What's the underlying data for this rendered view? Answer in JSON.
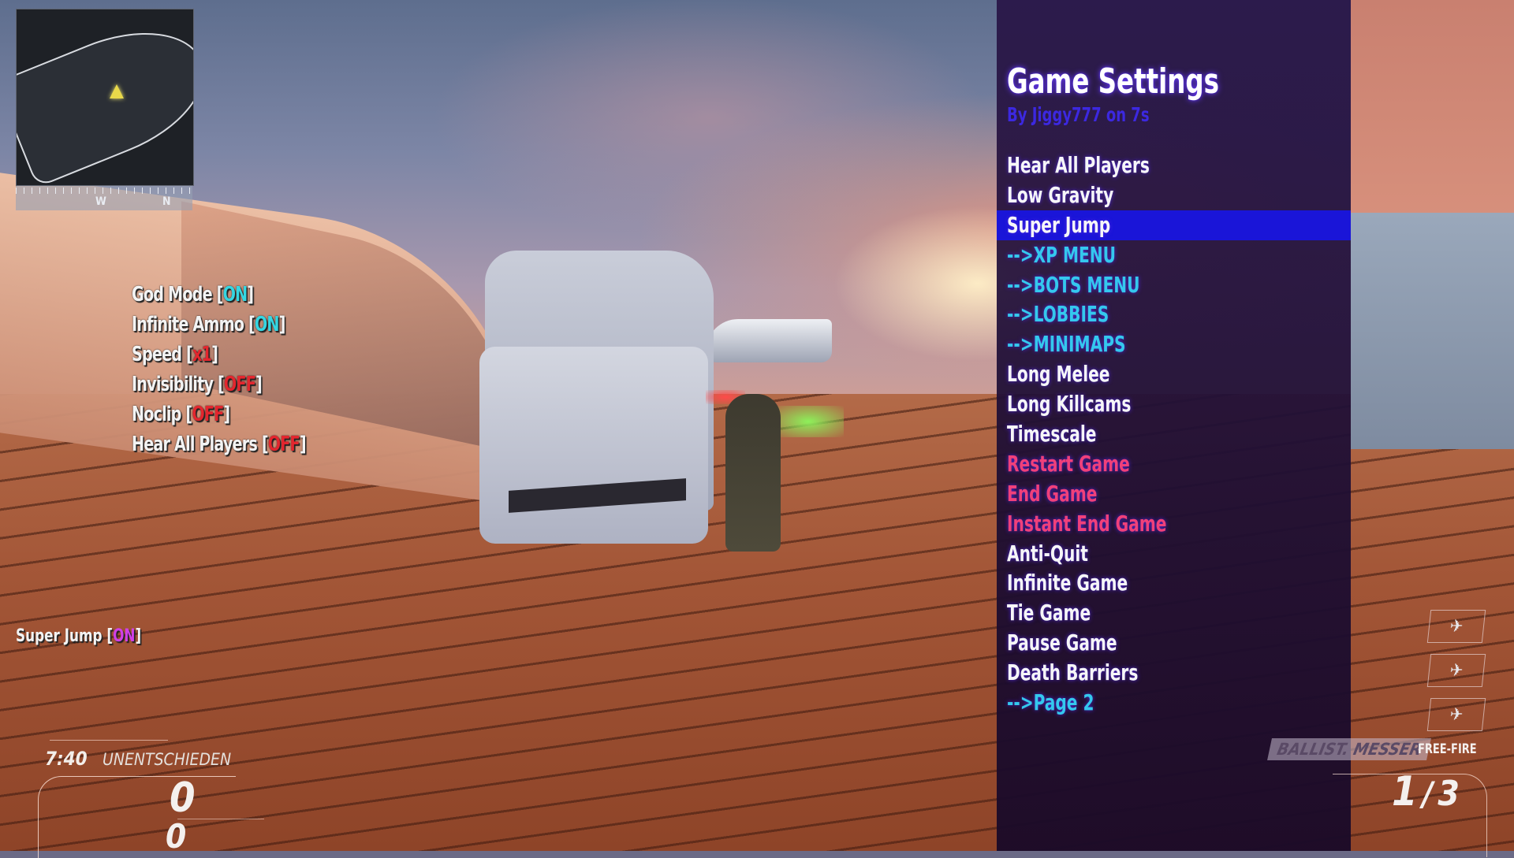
{
  "minimap": {
    "compass_labels": [
      "W",
      "N"
    ]
  },
  "status_list": [
    {
      "label": "God Mode",
      "value": "ON",
      "state": "on"
    },
    {
      "label": "Infinite Ammo",
      "value": "ON",
      "state": "on"
    },
    {
      "label": "Speed",
      "value": "x1",
      "state": "off"
    },
    {
      "label": "Invisibility",
      "value": "OFF",
      "state": "off"
    },
    {
      "label": "Noclip",
      "value": "OFF",
      "state": "off"
    },
    {
      "label": "Hear All Players",
      "value": "OFF",
      "state": "off"
    }
  ],
  "notification": {
    "label": "Super Jump",
    "value": "ON"
  },
  "menu": {
    "title": "Game Settings",
    "subtitle": "By Jiggy777 on 7s",
    "selected_index": 2,
    "items": [
      {
        "label": "Hear All Players",
        "color": "white"
      },
      {
        "label": "Low Gravity",
        "color": "white"
      },
      {
        "label": "Super Jump",
        "color": "white"
      },
      {
        "label": "-->XP MENU",
        "color": "cyan"
      },
      {
        "label": "-->BOTS MENU",
        "color": "cyan"
      },
      {
        "label": "-->LOBBIES",
        "color": "cyan"
      },
      {
        "label": "-->MINIMAPS",
        "color": "cyan"
      },
      {
        "label": "Long Melee",
        "color": "white"
      },
      {
        "label": "Long Killcams",
        "color": "white"
      },
      {
        "label": "Timescale",
        "color": "white"
      },
      {
        "label": "Restart Game",
        "color": "pink"
      },
      {
        "label": "End Game",
        "color": "pink"
      },
      {
        "label": "Instant End Game",
        "color": "pink"
      },
      {
        "label": "Anti-Quit",
        "color": "white"
      },
      {
        "label": "Infinite Game",
        "color": "white"
      },
      {
        "label": "Tie Game",
        "color": "white"
      },
      {
        "label": "Pause Game",
        "color": "white"
      },
      {
        "label": "Death Barriers",
        "color": "white"
      },
      {
        "label": "-->Page 2",
        "color": "cyan"
      }
    ]
  },
  "score_hud": {
    "time": "7:40",
    "status": "UNENTSCHIEDEN",
    "team_score": "0",
    "enemy_score": "0"
  },
  "weapon_hud": {
    "weapon_name": "BALLIST. MESSER",
    "fire_mode": "FREE-FIRE",
    "ammo_clip": "1",
    "ammo_separator": "/",
    "ammo_reserve": "3"
  },
  "killstreaks": [
    {
      "name": "drone-icon",
      "glyph": "✈"
    },
    {
      "name": "jet-icon",
      "glyph": "✈"
    },
    {
      "name": "plane-icon",
      "glyph": "✈"
    }
  ],
  "colors": {
    "menu_highlight": "#1a15d8",
    "menu_title_glow": "#6a3cff",
    "menu_subtitle": "#3c28e0",
    "item_white": "#f6f6f8",
    "item_cyan": "#34c8ee",
    "item_pink": "#f0407a",
    "status_on": "#35d6e2",
    "status_off": "#e3262e",
    "notify_on": "#d040e8"
  }
}
